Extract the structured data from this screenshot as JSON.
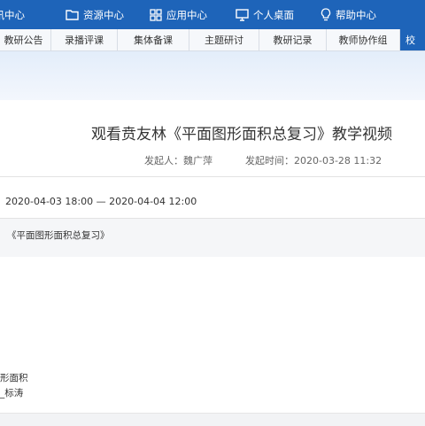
{
  "nav": {
    "items": [
      {
        "label": "资讯中心",
        "icon": "news-icon"
      },
      {
        "label": "资源中心",
        "icon": "folder-icon"
      },
      {
        "label": "应用中心",
        "icon": "grid-icon"
      },
      {
        "label": "个人桌面",
        "icon": "monitor-icon"
      },
      {
        "label": "帮助中心",
        "icon": "lightbulb-icon"
      }
    ]
  },
  "subnav": {
    "tabs": [
      "教研公告",
      "录播评课",
      "集体备课",
      "主题研讨",
      "教研记录",
      "教师协作组",
      "校"
    ],
    "active_index": 6
  },
  "article": {
    "title": "观看贲友林《平面图形面积总复习》教学视频",
    "initiator": "发起人：魏广萍",
    "created": "发起时间：2020-03-28 11:32",
    "date_range": "2020-04-03 18:00 — 2020-04-04 12:00",
    "video_link": "《平面图形面积总复习》",
    "fragment_1": "形面积",
    "fragment_2": "_标涛"
  },
  "colors": {
    "brand": "#1e64b9",
    "banner": "#e8f0fb"
  }
}
